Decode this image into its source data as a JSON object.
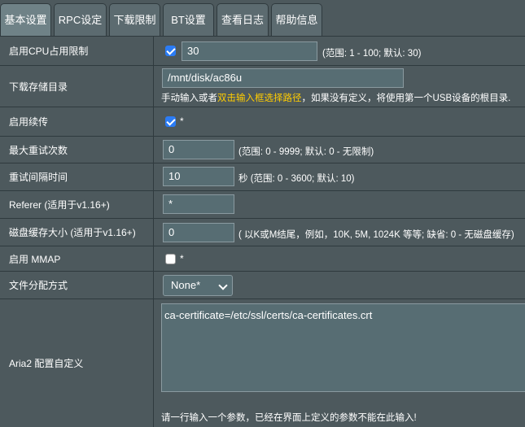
{
  "tabs": [
    {
      "label": "基本设置",
      "active": true
    },
    {
      "label": "RPC设定",
      "active": false
    },
    {
      "label": "下载限制",
      "active": false
    },
    {
      "label": "BT设置",
      "active": false
    },
    {
      "label": "查看日志",
      "active": false
    },
    {
      "label": "帮助信息",
      "active": false
    }
  ],
  "rows": {
    "cpu_limit": {
      "label": "启用CPU占用限制",
      "checked": true,
      "value": "30",
      "hint": "(范围: 1 - 100; 默认: 30)"
    },
    "download_dir": {
      "label": "下载存储目录",
      "value": "/mnt/disk/ac86u",
      "hint_pre": "手动输入或者",
      "hint_highlight": "双击输入框选择路径",
      "hint_post": "，如果没有定义，将使用第一个USB设备的根目录."
    },
    "continue": {
      "label": "启用续传",
      "checked": true,
      "star": "*"
    },
    "max_tries": {
      "label": "最大重试次数",
      "value": "0",
      "hint": "(范围: 0 - 9999; 默认: 0 - 无限制)"
    },
    "retry_wait": {
      "label": "重试间隔时间",
      "value": "10",
      "hint": "秒 (范围: 0 - 3600; 默认: 10)"
    },
    "referer": {
      "label": "Referer (适用于v1.16+)",
      "value": "*"
    },
    "disk_cache": {
      "label": "磁盘缓存大小 (适用于v1.16+)",
      "value": "0",
      "hint": "( 以K或M结尾，例如，10K, 5M, 1024K 等等; 缺省: 0 - 无磁盘缓存)"
    },
    "mmap": {
      "label": "启用 MMAP",
      "checked": false,
      "star": "*"
    },
    "file_alloc": {
      "label": "文件分配方式",
      "selected": "None*"
    },
    "custom_conf": {
      "label": "Aria2 配置自定义",
      "value": "ca-certificate=/etc/ssl/certs/ca-certificates.crt",
      "hint": "请一行输入一个参数，已经在界面上定义的参数不能在此输入!"
    }
  },
  "colors": {
    "panel": "#4d595d",
    "input": "#576d73",
    "border": "#2f3a3e",
    "highlight": "#ffcc00",
    "checkbox": "#2b7cf5"
  }
}
